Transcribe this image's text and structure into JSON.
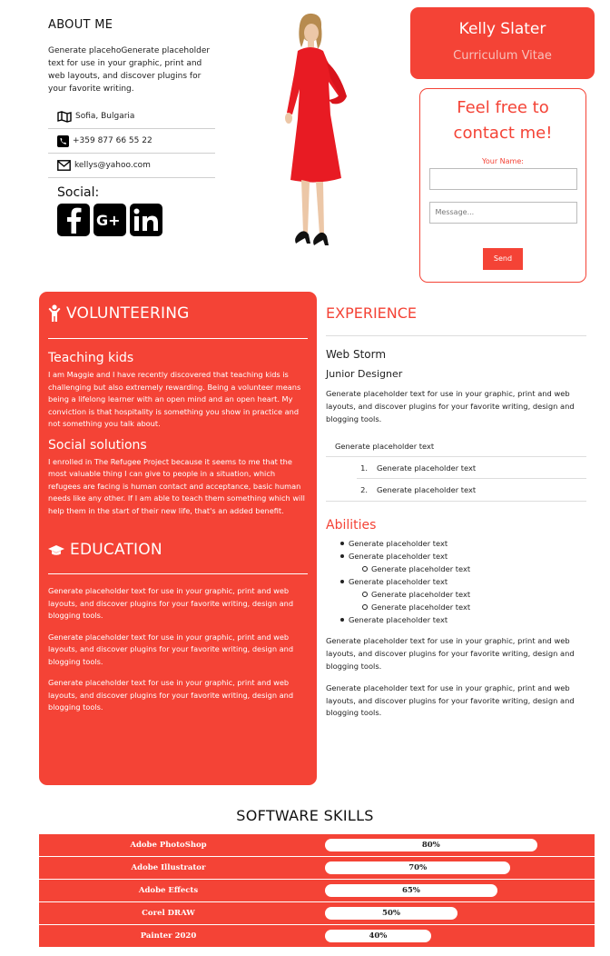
{
  "about": {
    "title": "ABOUT ME",
    "text": "Generate placehoGenerate placeholder text for use in your graphic, print and web layouts, and discover plugins for your favorite writing.",
    "location": "Sofia, Bulgaria",
    "phone": "+359 877 66 55 22",
    "email": "kellys@yahoo.com",
    "social_title": "Social:",
    "social_icons": [
      "facebook-icon",
      "google-plus-icon",
      "linkedin-icon"
    ]
  },
  "header": {
    "name": "Kelly Slater",
    "subtitle": "Curriculum Vitae"
  },
  "contact_form": {
    "heading_line1": "Feel free to",
    "heading_line2": "contact me!",
    "name_label": "Your Name:",
    "name_value": "",
    "message_placeholder": "Message...",
    "send_label": "Send"
  },
  "volunteering": {
    "title": "VOLUNTEERING",
    "items": [
      {
        "heading": "Teaching kids",
        "text": "I am Maggie and I have recently discovered that teaching kids is challenging but also extremely rewarding. Being a volunteer means being a lifelong learner with an open mind and an open heart. My conviction is that hospitality is something you show in practice and not something you talk about."
      },
      {
        "heading": "Social solutions",
        "text": "I enrolled in The Refugee Project because it seems to me that the most valuable thing I can give to people in a situation, which refugees are facing is human contact and acceptance, basic human needs like any other. If I am able to teach them something which will help them in the start of their new life, that's an added benefit."
      }
    ]
  },
  "education": {
    "title": "EDUCATION",
    "paragraphs": [
      "Generate placeholder text for use in your graphic, print and web layouts, and discover plugins for your favorite writing, design and blogging tools.",
      "Generate placeholder text for use in your graphic, print and web layouts, and discover plugins for your favorite writing, design and blogging tools.",
      "Generate placeholder text for use in your graphic, print and web layouts, and discover plugins for your favorite writing, design and blogging tools."
    ]
  },
  "experience": {
    "title": "EXPERIENCE",
    "company": "Web Storm",
    "role": "Junior Designer",
    "description": "Generate placeholder text for use in your graphic, print and web layouts, and discover plugins for your favorite writing, design and blogging tools.",
    "plain_item": "Generate placeholder text",
    "ordered_items": [
      {
        "number": "1.",
        "text": "Generate placeholder text"
      },
      {
        "number": "2.",
        "text": "Generate placeholder text"
      }
    ]
  },
  "abilities": {
    "title": "Abilities",
    "bullets": [
      {
        "level": 1,
        "text": "Generate placeholder text"
      },
      {
        "level": 1,
        "text": "Generate placeholder text"
      },
      {
        "level": 2,
        "text": "Generate placeholder text"
      },
      {
        "level": 1,
        "text": "Generate placeholder text"
      },
      {
        "level": 2,
        "text": "Generate placeholder text"
      },
      {
        "level": 2,
        "text": "Generate placeholder text"
      },
      {
        "level": 1,
        "text": "Generate placeholder text"
      }
    ],
    "paragraphs": [
      "Generate placeholder text for use in your graphic, print and web layouts, and discover plugins for your favorite writing, design and blogging tools.",
      "Generate placeholder text for use in your graphic, print and web layouts, and discover plugins for your favorite writing, design and blogging tools."
    ]
  },
  "software_skills": {
    "title": "SOFTWARE SKILLS",
    "skills": [
      {
        "name": "Adobe PhotoShop",
        "percent_label": "80%",
        "level": 0.8
      },
      {
        "name": "Adobe Illustrator",
        "percent_label": "70%",
        "level": 0.7
      },
      {
        "name": "Adobe Effects",
        "percent_label": "65%",
        "level": 0.65
      },
      {
        "name": "Corel DRAW",
        "percent_label": "50%",
        "level": 0.5
      },
      {
        "name": "Painter 2020",
        "percent_label": "40%",
        "level": 0.4
      }
    ]
  },
  "colors": {
    "accent": "#f44336",
    "accent_light_text": "#f7c1bc",
    "white": "#ffffff"
  }
}
